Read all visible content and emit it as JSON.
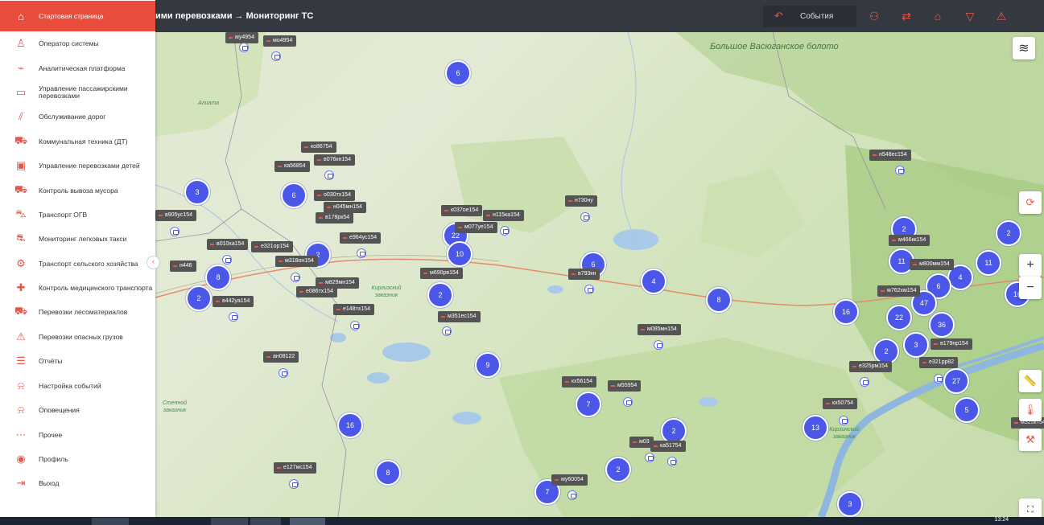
{
  "header": {
    "breadcrumb": "ими перевозками → Мониторинг ТС",
    "events_label": "События",
    "events_icon": "undo-arrow-icon",
    "icons": [
      "people-icon",
      "routes-icon",
      "depot-icon",
      "filter-icon",
      "warning-icon"
    ]
  },
  "sidebar": {
    "items": [
      {
        "label": "Стартовая страница",
        "icon": "home-icon"
      },
      {
        "label": "Оператор системы",
        "icon": "operator-icon"
      },
      {
        "label": "Аналитическая платформа",
        "icon": "analytics-icon"
      },
      {
        "label": "Управление пассажирскими перевозками",
        "icon": "bus-icon"
      },
      {
        "label": "Обслуживание дорог",
        "icon": "road-icon"
      },
      {
        "label": "Коммунальная техника (ДТ)",
        "icon": "sweeper-icon"
      },
      {
        "label": "Управление перевозками детей",
        "icon": "school-bus-icon"
      },
      {
        "label": "Контроль вывоза мусора",
        "icon": "garbage-truck-icon"
      },
      {
        "label": "Транспорт ОГВ",
        "icon": "government-car-icon"
      },
      {
        "label": "Мониторинг легковых такси",
        "icon": "taxi-icon"
      },
      {
        "label": "Транспорт сельского хозяйства",
        "icon": "tractor-icon"
      },
      {
        "label": "Контроль медицинского транспорта",
        "icon": "ambulance-icon"
      },
      {
        "label": "Перевозки лесоматериалов",
        "icon": "timber-truck-icon"
      },
      {
        "label": "Перевозки опасных грузов",
        "icon": "hazard-icon"
      },
      {
        "label": "Отчёты",
        "icon": "report-icon"
      },
      {
        "label": "Настройка событий",
        "icon": "bell-settings-icon"
      },
      {
        "label": "Оповещения",
        "icon": "bell-icon"
      },
      {
        "label": "Прочее",
        "icon": "more-icon"
      },
      {
        "label": "Профиль",
        "icon": "profile-icon"
      },
      {
        "label": "Выход",
        "icon": "exit-icon"
      }
    ]
  },
  "map": {
    "places": [
      "Большое Васюганское болото",
      "Алиата",
      "Киргизский заказник",
      "Степной заказник",
      "Кирзинский заказник"
    ],
    "clusters": [
      "6",
      "3",
      "6",
      "2",
      "8",
      "2",
      "22",
      "10",
      "2",
      "6",
      "4",
      "8",
      "9",
      "7",
      "16",
      "2",
      "7",
      "2",
      "8",
      "16",
      "11",
      "2",
      "4",
      "11",
      "2",
      "16",
      "2",
      "3",
      "27",
      "5",
      "13",
      "3",
      "36",
      "22",
      "6",
      "47"
    ],
    "vehicles": [
      "му4954",
      "мо4954",
      "ко86754",
      "ка56854",
      "в076кн154",
      "о030тх154",
      "н045мн154",
      "в178рк54",
      "в905ус154",
      "е964ус154",
      "в010ха154",
      "е321ор154",
      "м318он154",
      "н446",
      "м829мн154",
      "е086тх154",
      "в442уа154",
      "е148тх154",
      "ан08122",
      "к037ое154",
      "н115ка154",
      "м077уе154",
      "м690рв154",
      "м351ес154",
      "н730ну",
      "в793кн",
      "м085мн154",
      "кх56154",
      "м55954",
      "м03",
      "ка51754",
      "му60054",
      "е127мс154",
      "н548ес154",
      "м466кк154",
      "м800мм154",
      "м762хм154",
      "в179нр154",
      "е321рр82",
      "е325рм154",
      "кх50754",
      "м325кт54"
    ]
  },
  "right_tools": [
    "layers-icon",
    "route-icon",
    "zoom-in-icon",
    "zoom-out-icon",
    "ruler-icon",
    "thermometer-icon",
    "road-work-icon",
    "fullscreen-icon"
  ],
  "taskbar": {
    "clock": "13:24"
  }
}
